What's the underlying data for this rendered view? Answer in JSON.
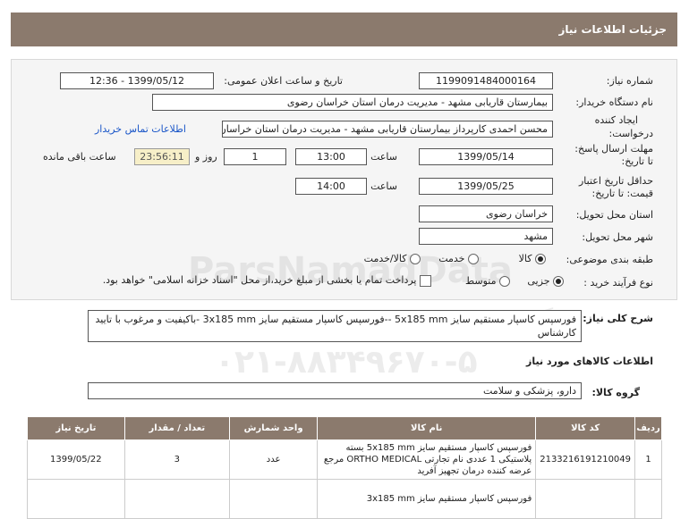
{
  "page_title": "جزئیات اطلاعات نیاز",
  "fields": {
    "need_number_label": "شماره نیاز:",
    "need_number": "1199091484000164",
    "announce_label": "تاریخ و ساعت اعلان عمومی:",
    "announce_value": "1399/05/12 - 12:36",
    "buyer_label": "نام دستگاه خریدار:",
    "buyer_value": "بیمارستان قاریابی مشهد - مدیریت درمان استان خراسان رضوی",
    "creator_label_1": "ایجاد کننده",
    "creator_label_2": "درخواست:",
    "creator_value": "محسن احمدی کارپرداز بیمارستان قاریابی مشهد - مدیریت درمان استان خراسان رضوی",
    "contact_link": "اطلاعات تماس خریدار",
    "deadline_label_1": "مهلت ارسال پاسخ:",
    "deadline_label_2": "تا تاریخ:",
    "deadline_date": "1399/05/14",
    "time_label": "ساعت",
    "deadline_time": "13:00",
    "days_value": "1",
    "days_label": "روز و",
    "remaining_time": "23:56:11",
    "remaining_label": "ساعت باقی مانده",
    "validity_label_1": "حداقل تاریخ اعتبار",
    "validity_label_2": "قیمت: تا تاریخ:",
    "validity_date": "1399/05/25",
    "validity_time": "14:00",
    "province_label": "استان محل تحویل:",
    "province_value": "خراسان رضوی",
    "city_label": "شهر محل تحویل:",
    "city_value": "مشهد",
    "category_label": "طبقه بندی موضوعی:",
    "category_options": [
      "کالا",
      "خدمت",
      "کالا/خدمت"
    ],
    "process_label": "نوع فرآیند خرید :",
    "process_options": [
      "جزیی",
      "متوسط"
    ],
    "payment_note": "پرداخت تمام یا بخشی از مبلغ خرید،از محل \"اسناد خزانه اسلامی\" خواهد بود.",
    "desc_label": "شرح کلی نیاز:",
    "desc_value": "فورسپس کاسپار مستقیم سایز 5x185 mm --فورسپس کاسپار مستقیم سایز 3x185 mm -باکیفیت و مرغوب با تایید کارشناس",
    "goods_info_title": "اطلاعات کالاهای مورد نیاز",
    "goods_group_label": "گروه کالا:",
    "goods_group_value": "دارو، پزشکی و سلامت"
  },
  "watermark": {
    "line1": "ParsNamadData",
    "line2": "پایگاه اطلاع رسانی مناقصه و مزایده",
    "line3": "۰۲۱-۸۸۳۴۹۶۷۰-۵"
  },
  "table": {
    "headers": [
      "ردیف",
      "کد کالا",
      "نام کالا",
      "واحد شمارش",
      "تعداد / مقدار",
      "تاریخ نیاز"
    ],
    "rows": [
      {
        "index": "1",
        "code": "2133216191210049",
        "name": "فورسپس کاسپار مستقیم سایز 5x185 mm بسته پلاستیکی 1 عددی نام تجارتی ORTHO MEDICAL مرجع عرضه کننده درمان تجهیز آفرید",
        "unit": "عدد",
        "qty": "3",
        "date": "1399/05/22"
      },
      {
        "index": "",
        "code": "",
        "name": "فورسپس کاسپار مستقیم سایز 3x185 mm",
        "unit": "",
        "qty": "",
        "date": ""
      }
    ]
  },
  "colors": {
    "header_bg": "#8b7a6d",
    "link": "#1a56c8",
    "timer_bg": "#f7efc8"
  }
}
